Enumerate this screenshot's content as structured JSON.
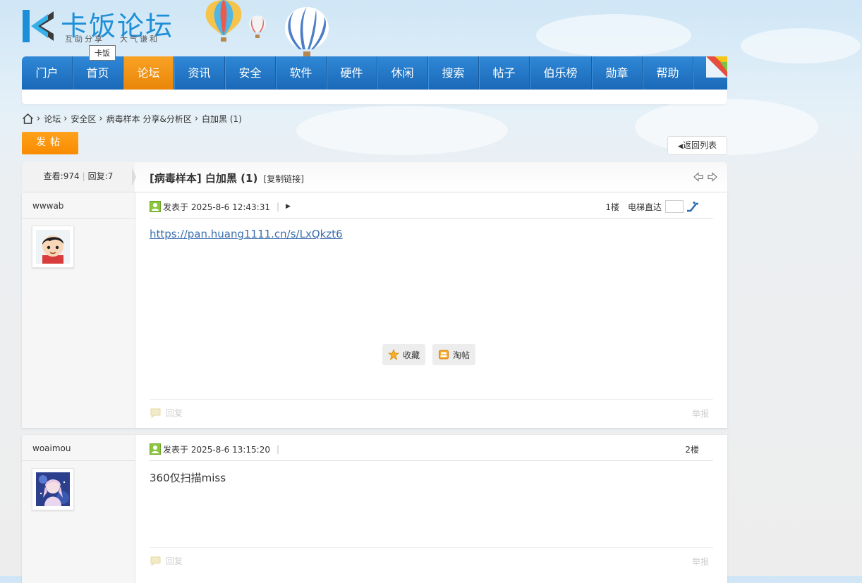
{
  "logo": {
    "title": "卡饭论坛",
    "slogan_left": "互助分享",
    "slogan_right": "大气谦和",
    "tooltip": "卡饭"
  },
  "nav": {
    "items": [
      "门户",
      "首页",
      "论坛",
      "资讯",
      "安全",
      "软件",
      "硬件",
      "休闲",
      "搜索",
      "帖子",
      "伯乐榜",
      "勋章",
      "帮助"
    ],
    "active_index": 2
  },
  "breadcrumb": [
    "论坛",
    "安全区",
    "病毒样本 分享&分析区",
    "白加黑 (1)"
  ],
  "buttons": {
    "new_post": "发帖",
    "back_to_list": "返回列表"
  },
  "thread": {
    "views_label": "查看:",
    "views": "974",
    "replies_label": "回复:",
    "replies": "7",
    "title": "[病毒样本] 白加黑 (1)",
    "copy_link": "[复制链接]"
  },
  "posts": [
    {
      "author": "wwwab",
      "posted": "发表于 2025-8-6 12:43:31",
      "floor": "1楼",
      "jump_label": "电梯直达",
      "link": "https://pan.huang1111.cn/s/LxQkzt6",
      "favorite": "收藏",
      "tao": "淘帖",
      "reply": "回复",
      "report": "举报"
    },
    {
      "author": "woaimou",
      "posted": "发表于 2025-8-6 13:15:20",
      "floor": "2楼",
      "text": "360仅扫描miss",
      "reply": "回复",
      "report": "举报"
    }
  ],
  "colors": {
    "nav_blue": "#1f74c4",
    "nav_active_orange": "#f39414",
    "post_button_orange": "#fa9400",
    "link_blue": "#3b6fad"
  }
}
